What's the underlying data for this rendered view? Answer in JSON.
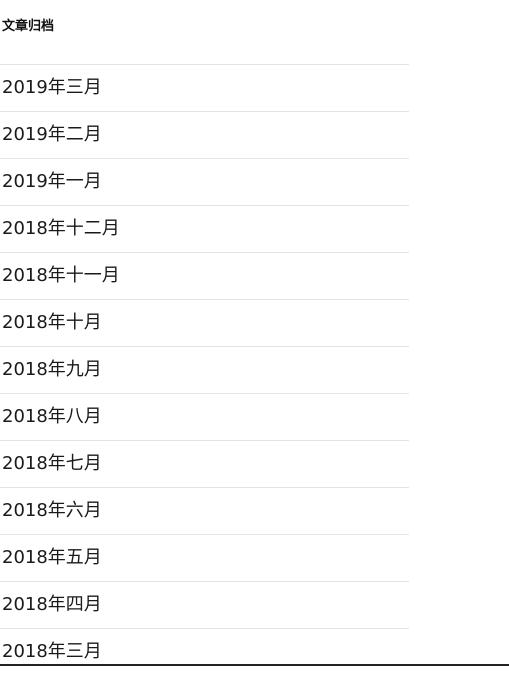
{
  "archive_widget": {
    "title": "文章归档",
    "items": [
      {
        "label": "2019年三月"
      },
      {
        "label": "2019年二月"
      },
      {
        "label": "2019年一月"
      },
      {
        "label": "2018年十二月"
      },
      {
        "label": "2018年十一月"
      },
      {
        "label": "2018年十月"
      },
      {
        "label": "2018年九月"
      },
      {
        "label": "2018年八月"
      },
      {
        "label": "2018年七月"
      },
      {
        "label": "2018年六月"
      },
      {
        "label": "2018年五月"
      },
      {
        "label": "2018年四月"
      },
      {
        "label": "2018年三月"
      }
    ]
  }
}
